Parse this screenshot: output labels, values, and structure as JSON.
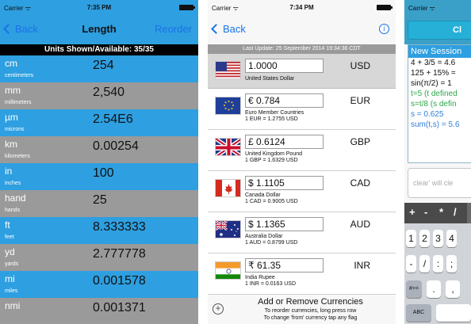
{
  "phone1": {
    "status": {
      "carrier": "Carrier ᯤ",
      "time": "7:35 PM"
    },
    "nav": {
      "back": "Back",
      "title": "Length",
      "right": "Reorder"
    },
    "header": "Units Shown/Available: 35/35",
    "rows": [
      {
        "sym": "cm",
        "name": "centimeters",
        "value": "254"
      },
      {
        "sym": "mm",
        "name": "millimeters",
        "value": "2,540"
      },
      {
        "sym": "µm",
        "name": "microns",
        "value": "2.54E6"
      },
      {
        "sym": "km",
        "name": "kilometers",
        "value": "0.00254"
      },
      {
        "sym": "in",
        "name": "inches",
        "value": "100"
      },
      {
        "sym": "hand",
        "name": "hands",
        "value": "25"
      },
      {
        "sym": "ft",
        "name": "feet",
        "value": "8.333333"
      },
      {
        "sym": "yd",
        "name": "yards",
        "value": "2.777778"
      },
      {
        "sym": "mi",
        "name": "miles",
        "value": "0.001578"
      },
      {
        "sym": "nmi",
        "name": "",
        "value": "0.001371"
      }
    ],
    "colors": {
      "blue": "#2e9fe0",
      "gray": "#9a9a9a"
    }
  },
  "phone2": {
    "status": {
      "carrier": "Carrier ᯤ",
      "time": "7:34 PM"
    },
    "nav": {
      "back": "Back"
    },
    "last_update": "Last Update: 25 September 2014 19:34:36 CDT",
    "base": {
      "value": "1.0000",
      "code": "USD",
      "name": "United States Dollar",
      "flag": "us-flag-icon"
    },
    "rows": [
      {
        "value": "€ 0.784",
        "code": "EUR",
        "name": "Euro Member Countries",
        "rate": "1 EUR = 1.2755 USD",
        "flag": "eu-flag-icon"
      },
      {
        "value": "£ 0.6124",
        "code": "GBP",
        "name": "United Kingdom Pound",
        "rate": "1 GBP = 1.6329 USD",
        "flag": "uk-flag-icon"
      },
      {
        "value": "$ 1.1105",
        "code": "CAD",
        "name": "Canada Dollar",
        "rate": "1 CAD = 0.9005 USD",
        "flag": "canada-flag-icon"
      },
      {
        "value": "$ 1.1365",
        "code": "AUD",
        "name": "Australia Dollar",
        "rate": "1 AUD = 0.8799 USD",
        "flag": "australia-flag-icon"
      },
      {
        "value": "₹ 61.35",
        "code": "INR",
        "name": "India Rupee",
        "rate": "1 INR = 0.0163 USD",
        "flag": "india-flag-icon"
      }
    ],
    "add": {
      "title": "Add or Remove Currencies",
      "line1": "To reorder currencies, long press row",
      "line2": "To change 'from' currency tap any flag"
    }
  },
  "phone3": {
    "status": {
      "carrier": "Carrier ᯤ"
    },
    "tab_label": "Cl",
    "session": "New Session",
    "lines": [
      {
        "text": "4 + 3/5 = 4.6",
        "color": "black"
      },
      {
        "text": "125 + 15% =",
        "color": "black"
      },
      {
        "text": "sin(π/2) = 1",
        "color": "black"
      },
      {
        "text": "t=5 (t defined",
        "color": "green"
      },
      {
        "text": "s=t/8 (s defin",
        "color": "green"
      },
      {
        "text": "s = 0.625",
        "color": "blue"
      },
      {
        "text": "sum(t,s) = 5.6",
        "color": "blue"
      }
    ],
    "input_placeholder": "clear' will cle",
    "keybar": [
      "+",
      "-",
      "*",
      "/"
    ],
    "keys": {
      "r1": [
        "1",
        "2",
        "3",
        "4"
      ],
      "r2": [
        "-",
        "/",
        ":",
        ";"
      ],
      "r3": [
        "#+=",
        ".",
        ","
      ],
      "abc": "ABC"
    }
  }
}
